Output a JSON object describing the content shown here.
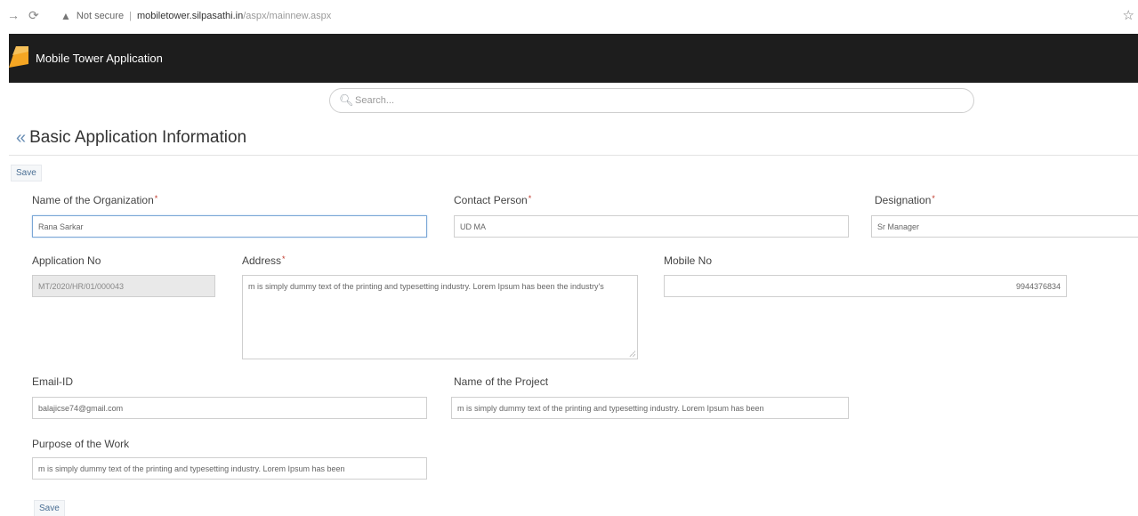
{
  "browser": {
    "security": "Not secure",
    "host": "mobiletower.silpasathi.in",
    "path": "/aspx/mainnew.aspx"
  },
  "app": {
    "title": "Mobile Tower Application"
  },
  "search": {
    "placeholder": "Search..."
  },
  "page": {
    "title": "Basic Application Information",
    "save_top": "Save",
    "save_bottom": "Save"
  },
  "form": {
    "organization": {
      "label": "Name of the Organization",
      "value": "Rana Sarkar"
    },
    "contact_person": {
      "label": "Contact Person",
      "value": "UD MA"
    },
    "designation": {
      "label": "Designation",
      "value": "Sr Manager"
    },
    "application_no": {
      "label": "Application No",
      "value": "MT/2020/HR/01/000043"
    },
    "address": {
      "label": "Address",
      "value": "m is simply dummy text of the printing and typesetting industry. Lorem Ipsum has been the industry's"
    },
    "mobile_no": {
      "label": "Mobile No",
      "value": "9944376834"
    },
    "email": {
      "label": "Email-ID",
      "value": "balajicse74@gmail.com"
    },
    "project_name": {
      "label": "Name of the Project",
      "value": "m is simply dummy text of the printing and typesetting industry. Lorem Ipsum has been"
    },
    "purpose": {
      "label": "Purpose of the Work",
      "value": "m is simply dummy text of the printing and typesetting industry. Lorem Ipsum has been"
    },
    "required_mark": "*"
  },
  "colors": {
    "header_bg": "#1d1d1d",
    "logo": "#f5a623",
    "accent": "#4a6f94"
  }
}
